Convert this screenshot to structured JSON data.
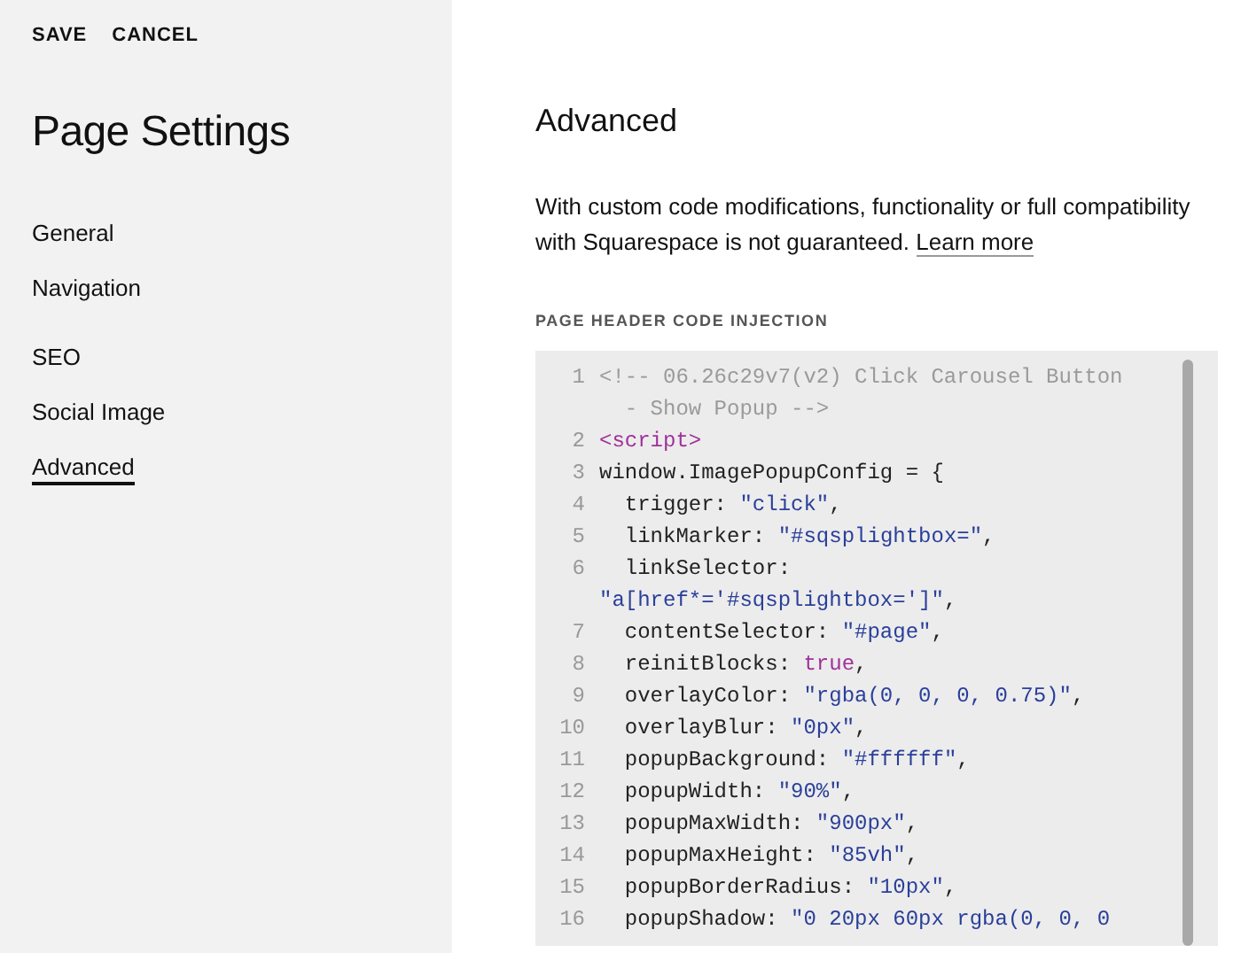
{
  "sidebar": {
    "actions": [
      "SAVE",
      "CANCEL"
    ],
    "title": "Page Settings",
    "groups": [
      {
        "items": [
          {
            "label": "General",
            "selected": false
          },
          {
            "label": "Navigation",
            "selected": false
          }
        ]
      },
      {
        "items": [
          {
            "label": "SEO",
            "selected": false
          },
          {
            "label": "Social Image",
            "selected": false
          },
          {
            "label": "Advanced",
            "selected": true
          }
        ]
      }
    ]
  },
  "main": {
    "title": "Advanced",
    "description": "With custom code modifications, functionality or full compatibility with Squarespace is not guaranteed.",
    "link": "Learn more",
    "section_label": "PAGE HEADER CODE INJECTION",
    "code_lines": [
      {
        "number": "1",
        "rows": [
          [
            {
              "kind": "comment",
              "text": "<!-- 06.26c29v7(v2) Click Carousel Button"
            }
          ],
          [
            {
              "kind": "comment",
              "text": "  - Show Popup -->"
            }
          ]
        ]
      },
      {
        "number": "2",
        "rows": [
          [
            {
              "kind": "tag",
              "text": "<script>"
            }
          ]
        ]
      },
      {
        "number": "3",
        "rows": [
          [
            {
              "kind": "plain",
              "text": "window.ImagePopupConfig = {"
            }
          ]
        ]
      },
      {
        "number": "4",
        "rows": [
          [
            {
              "kind": "plain",
              "text": "  trigger: "
            },
            {
              "kind": "string",
              "text": "\"click\""
            },
            {
              "kind": "plain",
              "text": ","
            }
          ]
        ]
      },
      {
        "number": "5",
        "rows": [
          [
            {
              "kind": "plain",
              "text": "  linkMarker: "
            },
            {
              "kind": "string",
              "text": "\"#sqsplightbox=\""
            },
            {
              "kind": "plain",
              "text": ","
            }
          ]
        ]
      },
      {
        "number": "6",
        "rows": [
          [
            {
              "kind": "plain",
              "text": "  linkSelector:"
            }
          ],
          [
            {
              "kind": "string",
              "text": "\"a[href*='#sqsplightbox=']\""
            },
            {
              "kind": "plain",
              "text": ","
            }
          ]
        ]
      },
      {
        "number": "7",
        "rows": [
          [
            {
              "kind": "plain",
              "text": "  contentSelector: "
            },
            {
              "kind": "string",
              "text": "\"#page\""
            },
            {
              "kind": "plain",
              "text": ","
            }
          ]
        ]
      },
      {
        "number": "8",
        "rows": [
          [
            {
              "kind": "plain",
              "text": "  reinitBlocks: "
            },
            {
              "kind": "keyword",
              "text": "true"
            },
            {
              "kind": "plain",
              "text": ","
            }
          ]
        ]
      },
      {
        "number": "9",
        "rows": [
          [
            {
              "kind": "plain",
              "text": "  overlayColor: "
            },
            {
              "kind": "string",
              "text": "\"rgba(0, 0, 0, 0.75)\""
            },
            {
              "kind": "plain",
              "text": ","
            }
          ]
        ]
      },
      {
        "number": "10",
        "rows": [
          [
            {
              "kind": "plain",
              "text": "  overlayBlur: "
            },
            {
              "kind": "string",
              "text": "\"0px\""
            },
            {
              "kind": "plain",
              "text": ","
            }
          ]
        ]
      },
      {
        "number": "11",
        "rows": [
          [
            {
              "kind": "plain",
              "text": "  popupBackground: "
            },
            {
              "kind": "string",
              "text": "\"#ffffff\""
            },
            {
              "kind": "plain",
              "text": ","
            }
          ]
        ]
      },
      {
        "number": "12",
        "rows": [
          [
            {
              "kind": "plain",
              "text": "  popupWidth: "
            },
            {
              "kind": "string",
              "text": "\"90%\""
            },
            {
              "kind": "plain",
              "text": ","
            }
          ]
        ]
      },
      {
        "number": "13",
        "rows": [
          [
            {
              "kind": "plain",
              "text": "  popupMaxWidth: "
            },
            {
              "kind": "string",
              "text": "\"900px\""
            },
            {
              "kind": "plain",
              "text": ","
            }
          ]
        ]
      },
      {
        "number": "14",
        "rows": [
          [
            {
              "kind": "plain",
              "text": "  popupMaxHeight: "
            },
            {
              "kind": "string",
              "text": "\"85vh\""
            },
            {
              "kind": "plain",
              "text": ","
            }
          ]
        ]
      },
      {
        "number": "15",
        "rows": [
          [
            {
              "kind": "plain",
              "text": "  popupBorderRadius: "
            },
            {
              "kind": "string",
              "text": "\"10px\""
            },
            {
              "kind": "plain",
              "text": ","
            }
          ]
        ]
      },
      {
        "number": "16",
        "rows": [
          [
            {
              "kind": "plain",
              "text": "  popupShadow: "
            },
            {
              "kind": "string",
              "text": "\"0 20px 60px rgba(0, 0, 0"
            }
          ]
        ]
      }
    ]
  }
}
